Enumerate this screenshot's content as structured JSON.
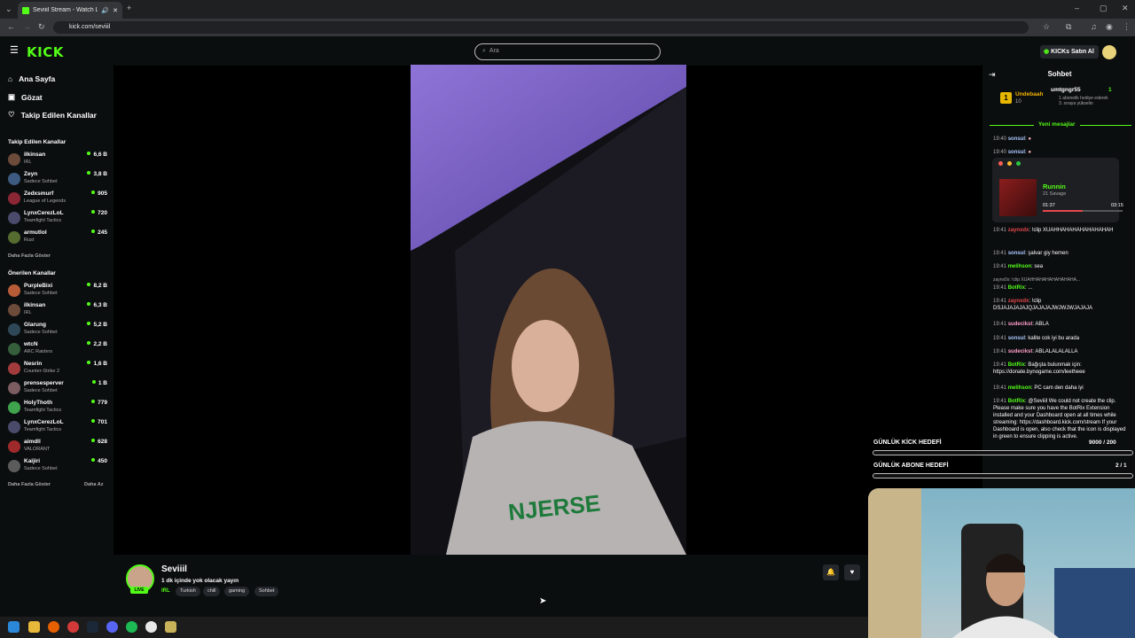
{
  "browser": {
    "tab_title": "Seviiil Stream - Watch Live",
    "url": "kick.com/seviiil"
  },
  "header": {
    "logo": "KICK",
    "search_placeholder": "Ara",
    "buy_button": "KICKs Satın Al"
  },
  "sidebar": {
    "nav": [
      "Ana Sayfa",
      "Gözat",
      "Takip Edilen Kanallar"
    ],
    "following_title": "Takip Edilen Kanallar",
    "following": [
      {
        "name": "ilkinsan",
        "category": "IRL",
        "viewers": "6,6 B"
      },
      {
        "name": "Zeyn",
        "category": "Sadece Sohbet",
        "viewers": "3,8 B"
      },
      {
        "name": "Zedxsmurf",
        "category": "League of Legends",
        "viewers": "905"
      },
      {
        "name": "LynxCerezLoL",
        "category": "Teamfight Tactics",
        "viewers": "720"
      },
      {
        "name": "armutlol",
        "category": "Rust",
        "viewers": "245"
      }
    ],
    "show_more": "Daha Fazla Göster",
    "recommended_title": "Önerilen Kanallar",
    "recommended": [
      {
        "name": "PurpleBixi",
        "category": "Sadece Sohbet",
        "viewers": "8,2 B"
      },
      {
        "name": "ilkinsan",
        "category": "IRL",
        "viewers": "6,3 B"
      },
      {
        "name": "Glarung",
        "category": "Sadece Sohbet",
        "viewers": "5,2 B"
      },
      {
        "name": "wtcN",
        "category": "ARC Raiders",
        "viewers": "2,2 B"
      },
      {
        "name": "Nesrin",
        "category": "Counter-Strike 2",
        "viewers": "1,6 B"
      },
      {
        "name": "prensesperver",
        "category": "Sadece Sohbet",
        "viewers": "1 B"
      },
      {
        "name": "HolyThoth",
        "category": "Teamfight Tactics",
        "viewers": "779"
      },
      {
        "name": "LynxCerezLoL",
        "category": "Teamfight Tactics",
        "viewers": "701"
      },
      {
        "name": "aimdll",
        "category": "VALORANT",
        "viewers": "628"
      },
      {
        "name": "Kaijiri",
        "category": "Sadece Sohbet",
        "viewers": "450"
      }
    ],
    "show_more_2": "Daha Fazla Göster",
    "show_less": "Daha Az"
  },
  "stream": {
    "name": "Seviiil",
    "title": "1 dk içinde yok olacak yayın",
    "category": "IRL",
    "tags": [
      "Turkish",
      "chill",
      "gaming",
      "Sohbet"
    ],
    "live_badge": "LIVE"
  },
  "chat": {
    "title": "Sohbet",
    "pinned_left": {
      "name": "Undebaah",
      "sub": "10"
    },
    "pinned_right": {
      "name": "umtgngr55",
      "count": "1",
      "text": "1 abonelik hediye ederek 3. sıraya yükselin"
    },
    "new_messages": "Yeni mesajlar",
    "messages_top": [
      {
        "time": "19:40",
        "user": "sonsul",
        "text": ""
      },
      {
        "time": "19:40",
        "user": "sonsul",
        "text": ""
      }
    ],
    "music": {
      "song": "Runnin",
      "artist": "21 Savage",
      "elapsed": "01:37",
      "total": "03:15",
      "progress": 0.5
    },
    "messages": [
      {
        "time": "19:41",
        "user": "zaynxdx",
        "text": "!clip XUAHHAHAHAHAHAHAHAH",
        "cls": "u-r"
      },
      {
        "time": "19:41",
        "user": "sonsul",
        "text": "şalvar giy hemen",
        "cls": "u-b"
      },
      {
        "time": "19:41",
        "user": "melihson",
        "text": "sea",
        "cls": "u-g"
      },
      {
        "time": "",
        "user": "",
        "text": "zaynx0x: !clip XUAHHAHAHAHAHAHAHA...",
        "cls": "t"
      },
      {
        "time": "19:41",
        "user": "BotRix",
        "text": "...",
        "cls": "u-g"
      },
      {
        "time": "19:41",
        "user": "zaynxdx",
        "text": "!clip DSJAJAJAJAJQJAJAJAJWJWJWJAJAJA",
        "cls": "u-r"
      },
      {
        "time": "19:41",
        "user": "sudecikst",
        "text": "ABLA",
        "cls": "u-p"
      },
      {
        "time": "19:41",
        "user": "sonsul",
        "text": "kalite cok iyi bu arada",
        "cls": "u-b"
      },
      {
        "time": "19:41",
        "user": "sudecikst",
        "text": "ABLALALALALLA",
        "cls": "u-p"
      },
      {
        "time": "19:41",
        "user": "BotRix",
        "text": "Bağışta bulunmak için: https://donate.bynogame.com/leetheee",
        "cls": "u-g"
      },
      {
        "time": "19:41",
        "user": "melihson",
        "text": "PC cam den daha iyi",
        "cls": "u-g"
      },
      {
        "time": "19:41",
        "user": "BotRix",
        "text": "@Seviiil We could not create the clip. Please make sure you have the BotRix Extension installed and your Dashboard open at all times while streaming: https://dashboard.kick.com/stream If your Dashboard is open, also check that the  icon is displayed in green to ensure clipping is active.",
        "cls": "u-g"
      }
    ]
  },
  "goals": [
    {
      "label": "GÜNLÜK KİCK HEDEFİ",
      "value": "9000 / 200"
    },
    {
      "label": "GÜNLÜK ABONE HEDEFİ",
      "value": "2 / 1"
    }
  ],
  "colors": {
    "brand": "#53fc18",
    "bg": "#0b0e0f"
  }
}
